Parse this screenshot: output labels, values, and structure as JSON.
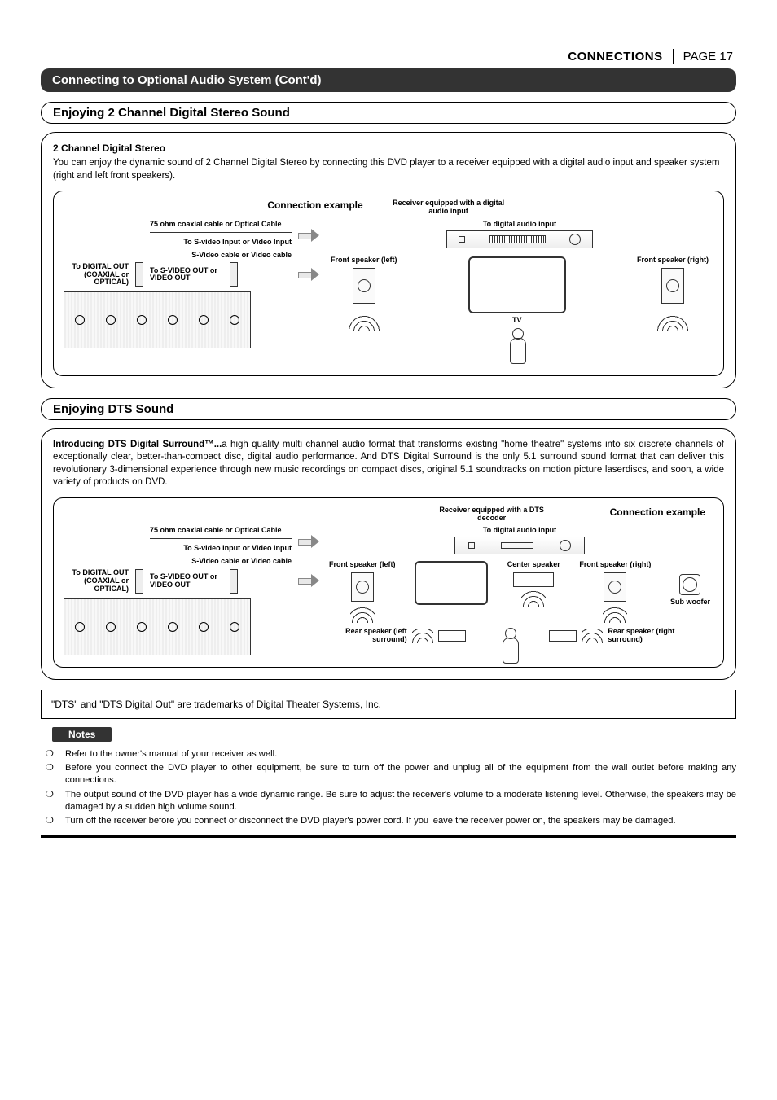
{
  "header": {
    "section": "CONNECTIONS",
    "page": "PAGE 17"
  },
  "title_bar": "Connecting to Optional Audio System (Cont'd)",
  "section1": {
    "title": "Enjoying 2 Channel Digital Stereo Sound",
    "heading": "2 Channel Digital Stereo",
    "body": "You can enjoy the dynamic sound of 2 Channel Digital Stereo by connecting this DVD player to a receiver equipped with a digital audio input and speaker system (right and left front speakers).",
    "diagram": {
      "conn_example": "Connection example",
      "receiver_label": "Receiver equipped with a digital audio input",
      "cable_label": "75 ohm coaxial cable or Optical Cable",
      "to_digital": "To digital audio input",
      "to_svideo_input": "To S-video Input or Video Input",
      "svideo_cable": "S-Video cable or Video cable",
      "to_digital_out": "To DIGITAL OUT (COAXIAL or OPTICAL)",
      "to_svideo_out": "To S-VIDEO OUT or VIDEO OUT",
      "front_left": "Front speaker (left)",
      "front_right": "Front speaker (right)",
      "tv": "TV"
    }
  },
  "section2": {
    "title": "Enjoying DTS Sound",
    "intro_bold": "Introducing DTS Digital Surround™...",
    "intro_rest": "a high quality multi channel audio format that transforms existing \"home theatre\" systems into six discrete channels of exceptionally clear, better-than-compact disc, digital audio performance. And DTS Digital Surround is the only 5.1 surround sound format that can deliver this revolutionary 3-dimensional experience through new music recordings on compact discs, original 5.1 soundtracks on motion picture laserdiscs, and soon, a wide variety of products on DVD.",
    "diagram": {
      "conn_example": "Connection example",
      "receiver_label": "Receiver equipped with a DTS decoder",
      "cable_label": "75 ohm coaxial cable or Optical Cable",
      "to_digital": "To digital audio input",
      "to_svideo_input": "To S-video Input or Video Input",
      "svideo_cable": "S-Video cable or Video cable",
      "to_digital_out": "To DIGITAL OUT (COAXIAL or OPTICAL)",
      "to_svideo_out": "To S-VIDEO OUT or VIDEO OUT",
      "front_left": "Front speaker (left)",
      "front_right": "Front speaker (right)",
      "center": "Center speaker",
      "sub": "Sub woofer",
      "rear_left": "Rear speaker (left surround)",
      "rear_right": "Rear speaker (right surround)"
    }
  },
  "trademark": "\"DTS\" and \"DTS Digital Out\" are trademarks of Digital Theater Systems, Inc.",
  "notes": {
    "title": "Notes",
    "items": [
      "Refer to the owner's manual of your receiver as well.",
      "Before you connect the DVD player to other equipment, be sure to turn off the power and unplug all of the equipment from the wall outlet before making any connections.",
      "The output sound of the DVD player has a wide dynamic range. Be sure to adjust the receiver's  volume to a moderate listening level. Otherwise, the speakers may be damaged by a sudden high volume sound.",
      "Turn off the receiver before you connect or disconnect the DVD player's  power cord. If you leave the receiver power on, the speakers may be damaged."
    ]
  }
}
